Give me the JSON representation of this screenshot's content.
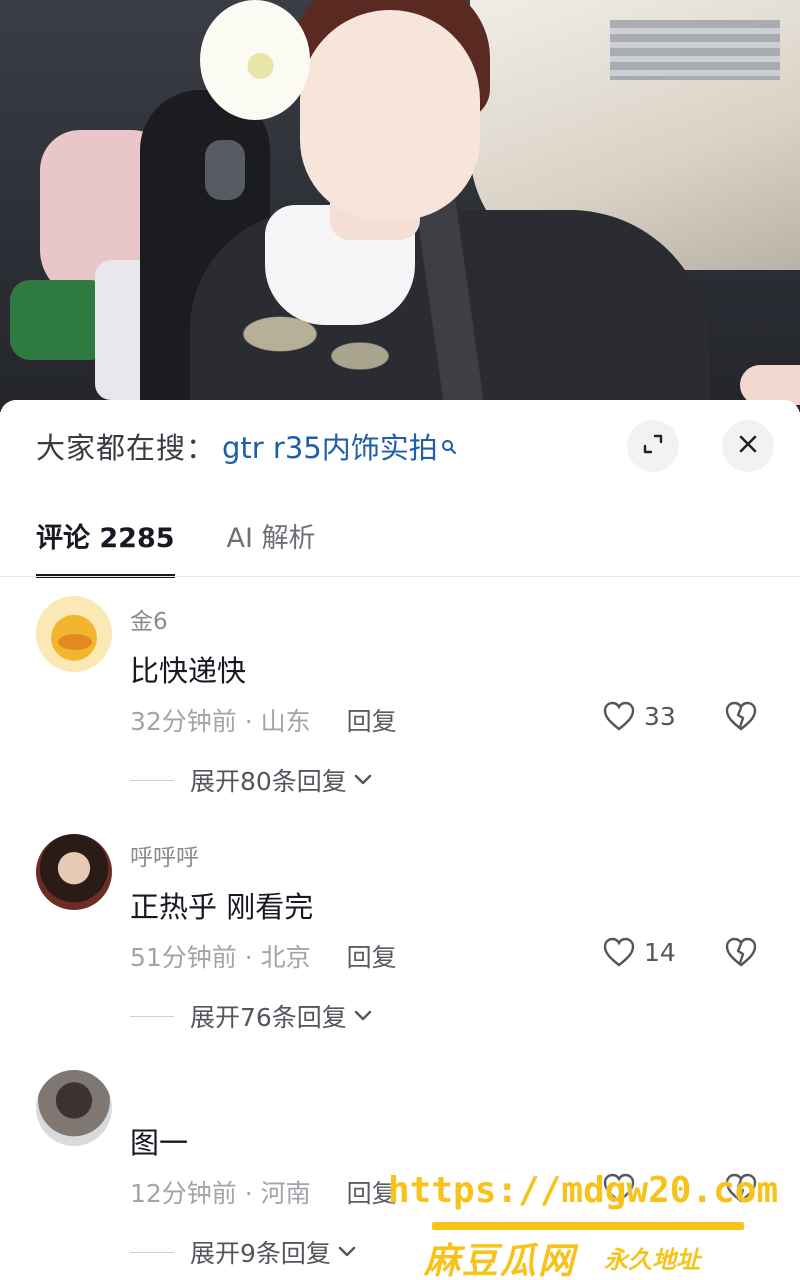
{
  "search": {
    "prefix": "大家都在搜：",
    "term": "gtr r35内饰实拍"
  },
  "tabs": [
    {
      "label": "评论 2285"
    },
    {
      "label": "AI 解析"
    }
  ],
  "comments": [
    {
      "name": "金6",
      "text": "比快递快",
      "time": "32分钟前 · 山东",
      "reply": "回复",
      "likes": "33",
      "expand": "展开80条回复"
    },
    {
      "name": "呼呼呼",
      "text": "正热乎 刚看完",
      "time": "51分钟前 · 北京",
      "reply": "回复",
      "likes": "14",
      "expand": "展开76条回复"
    },
    {
      "name": "",
      "text": "图一",
      "time": "12分钟前 · 河南",
      "reply": "回复",
      "likes": "",
      "expand": "展开9条回复"
    }
  ],
  "watermark": {
    "url": "https://mdgw20.com",
    "name": "麻豆瓜网",
    "sub": "永久地址"
  },
  "icons": {
    "search": "search-icon",
    "expand": "expand-icon",
    "close": "close-icon",
    "like": "heart-icon",
    "dislike": "broken-heart-icon",
    "chevron": "chevron-down-icon"
  }
}
